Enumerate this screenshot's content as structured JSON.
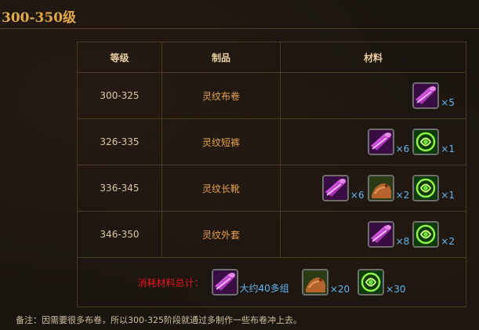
{
  "heading": "300-350级",
  "table": {
    "headers": {
      "level": "等级",
      "item": "制品",
      "materials": "材料"
    },
    "rows": [
      {
        "level": "300-325",
        "item": "灵纹布卷",
        "materials": [
          {
            "icon": "cloth-roll-icon",
            "qty": "×5"
          }
        ]
      },
      {
        "level": "326-335",
        "item": "灵纹短裤",
        "materials": [
          {
            "icon": "cloth-roll-icon",
            "qty": "×6"
          },
          {
            "icon": "green-rune-icon",
            "qty": "×1"
          }
        ]
      },
      {
        "level": "336-345",
        "item": "灵纹长靴",
        "materials": [
          {
            "icon": "cloth-roll-icon",
            "qty": "×6"
          },
          {
            "icon": "leather-icon",
            "qty": "×2"
          },
          {
            "icon": "green-rune-icon",
            "qty": "×1"
          }
        ]
      },
      {
        "level": "346-350",
        "item": "灵纹外套",
        "materials": [
          {
            "icon": "cloth-roll-icon",
            "qty": "×8"
          },
          {
            "icon": "green-rune-icon",
            "qty": "×2"
          }
        ]
      }
    ],
    "total": {
      "label": "消耗材料总计：",
      "materials": [
        {
          "icon": "cloth-roll-icon",
          "qty": "大约40多组"
        },
        {
          "icon": "leather-icon",
          "qty": "×20"
        },
        {
          "icon": "green-rune-icon",
          "qty": "×30"
        }
      ]
    }
  },
  "note": "备注：因需要很多布卷，所以300-325阶段就通过多制作一些布卷冲上去。",
  "colors": {
    "heading": "#e0a94a",
    "item": "#e7a349",
    "qty": "#5fb6f0",
    "total_label": "#e8181e",
    "border": "#4b3a22"
  }
}
